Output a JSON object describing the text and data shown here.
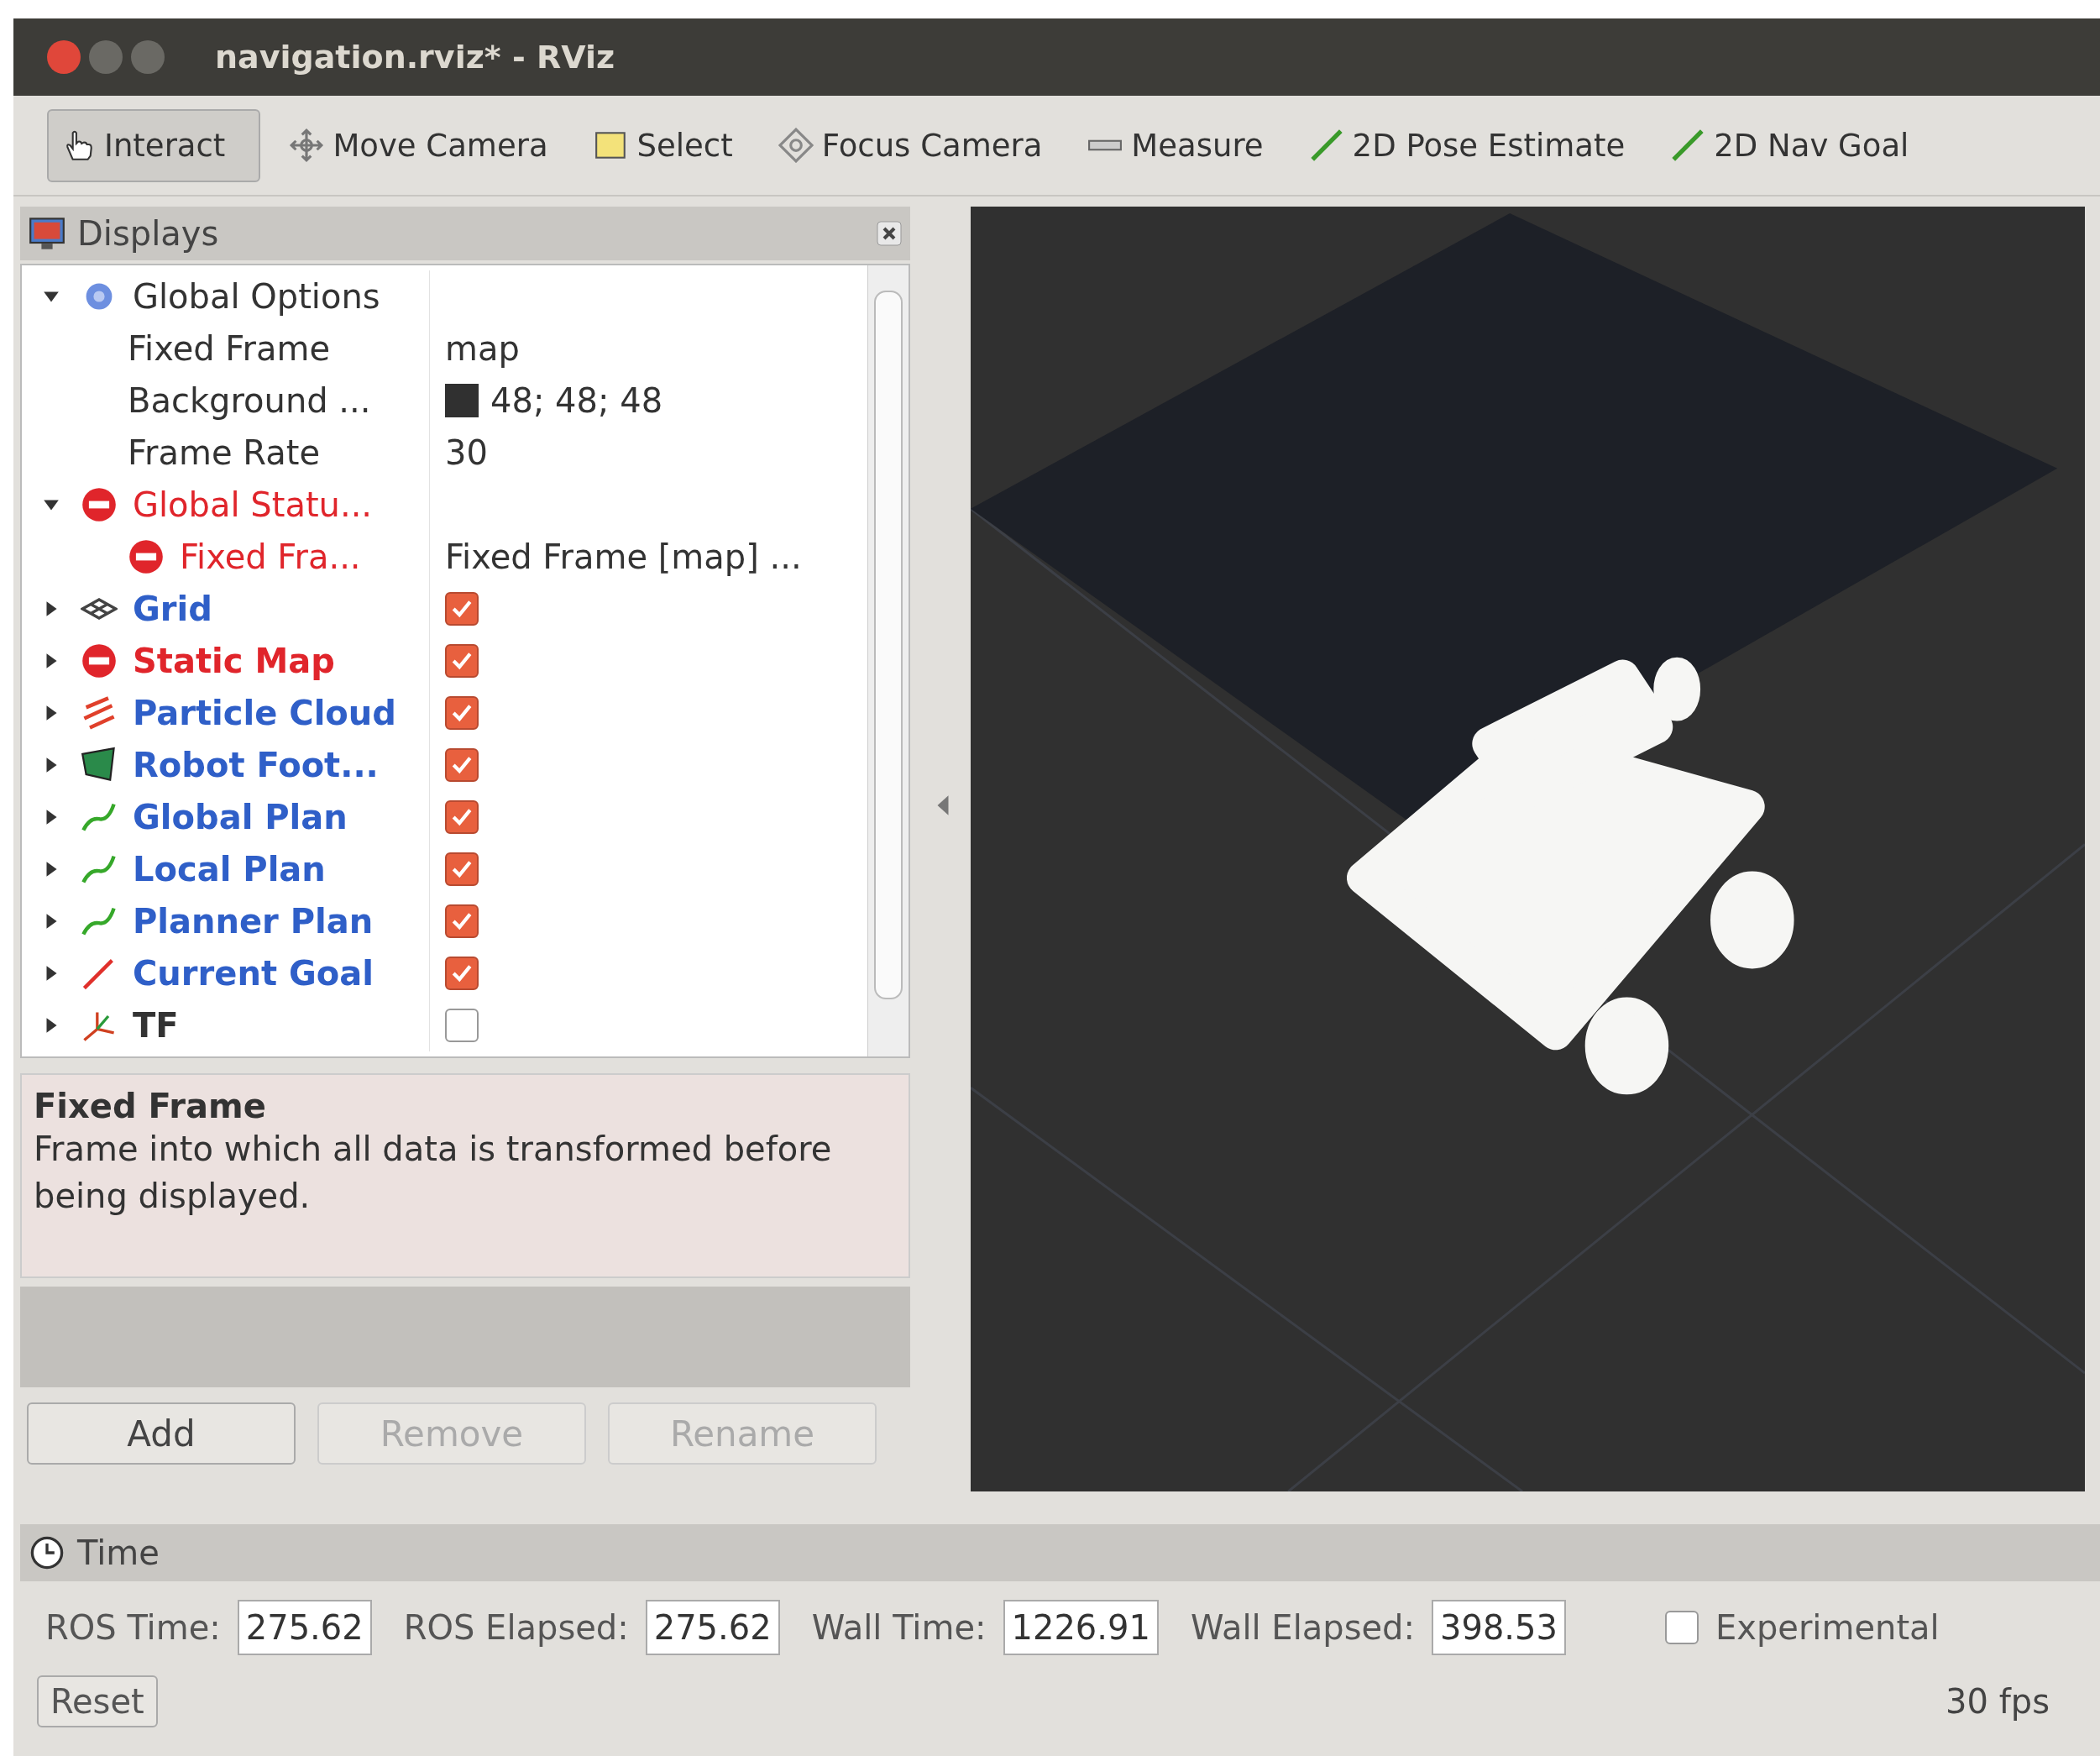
{
  "window": {
    "title": "navigation.rviz* - RViz"
  },
  "toolbar": [
    {
      "kind": "interact",
      "label": "Interact",
      "selected": true
    },
    {
      "kind": "move",
      "label": "Move Camera",
      "selected": false
    },
    {
      "kind": "select",
      "label": "Select",
      "selected": false
    },
    {
      "kind": "focus",
      "label": "Focus Camera",
      "selected": false
    },
    {
      "kind": "measure",
      "label": "Measure",
      "selected": false
    },
    {
      "kind": "pose",
      "label": "2D Pose Estimate",
      "selected": false
    },
    {
      "kind": "goal",
      "label": "2D Nav Goal",
      "selected": false
    }
  ],
  "displays": {
    "title": "Displays",
    "tree": [
      {
        "kind": "options",
        "label": "Global Options",
        "expanded": true,
        "children": [
          {
            "kind": "property",
            "label": "Fixed Frame",
            "value": "map"
          },
          {
            "kind": "property",
            "label": "Background ...",
            "value": "48; 48; 48",
            "color": "#303030"
          },
          {
            "kind": "property",
            "label": "Frame Rate",
            "value": "30"
          }
        ]
      },
      {
        "kind": "status",
        "label": "Global Statu...",
        "error": true,
        "expanded": true,
        "children": [
          {
            "kind": "status",
            "label": "Fixed Fra...",
            "error": true,
            "value": "Fixed Frame [map] ..."
          }
        ]
      },
      {
        "kind": "grid",
        "label": "Grid",
        "error": false,
        "checked": true,
        "expanded": false
      },
      {
        "kind": "map",
        "label": "Static Map",
        "error": true,
        "checked": true,
        "expanded": false
      },
      {
        "kind": "particles",
        "label": "Particle Cloud",
        "error": false,
        "checked": true,
        "expanded": false
      },
      {
        "kind": "polygon",
        "label": "Robot Foot...",
        "error": false,
        "checked": true,
        "expanded": false
      },
      {
        "kind": "path",
        "label": "Global Plan",
        "error": false,
        "checked": true,
        "expanded": false
      },
      {
        "kind": "path",
        "label": "Local Plan",
        "error": false,
        "checked": true,
        "expanded": false
      },
      {
        "kind": "path",
        "label": "Planner Plan",
        "error": false,
        "checked": true,
        "expanded": false
      },
      {
        "kind": "pose",
        "label": "Current Goal",
        "error": false,
        "checked": true,
        "expanded": false
      },
      {
        "kind": "tf",
        "label": "TF",
        "error": false,
        "checked": false,
        "expanded": false
      }
    ],
    "help": {
      "title": "Fixed Frame",
      "text": "Frame into which all data is transformed before being displayed."
    },
    "buttons": [
      {
        "label": "Add",
        "disabled": false
      },
      {
        "label": "Remove",
        "disabled": true
      },
      {
        "label": "Rename",
        "disabled": true
      }
    ]
  },
  "time": {
    "title": "Time",
    "fields": [
      {
        "label": "ROS Time:",
        "value": "275.62"
      },
      {
        "label": "ROS Elapsed:",
        "value": "275.62"
      },
      {
        "label": "Wall Time:",
        "value": "1226.91"
      },
      {
        "label": "Wall Elapsed:",
        "value": "398.53"
      }
    ],
    "experimental": {
      "label": "Experimental",
      "checked": false
    },
    "reset": "Reset",
    "fps": "30 fps"
  }
}
